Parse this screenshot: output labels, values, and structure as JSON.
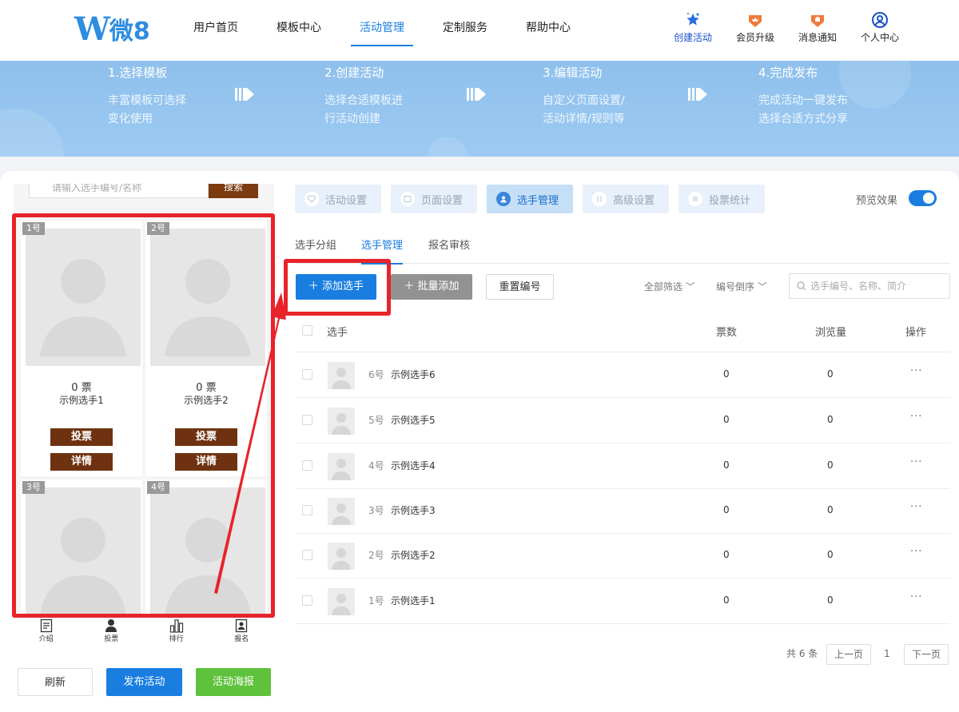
{
  "header": {
    "logo": {
      "w": "W",
      "text": "微8"
    },
    "nav": [
      "用户首页",
      "模板中心",
      "活动管理",
      "定制服务",
      "帮助中心"
    ],
    "active_nav": "活动管理",
    "icons": [
      {
        "label": "创建活动",
        "icon": "star-icon",
        "color": "#1a50c8"
      },
      {
        "label": "会员升级",
        "icon": "crown-badge-icon",
        "color": "#f07a3a"
      },
      {
        "label": "消息通知",
        "icon": "bell-badge-icon",
        "color": "#f07a3a"
      },
      {
        "label": "个人中心",
        "icon": "user-icon",
        "color": "#1a50c8"
      }
    ]
  },
  "banner": {
    "steps": [
      {
        "title": "1.选择模板",
        "l1": "丰富模板可选择",
        "l2": "变化使用"
      },
      {
        "title": "2.创建活动",
        "l1": "选择合适模板进",
        "l2": "行活动创建"
      },
      {
        "title": "3.编辑活动",
        "l1": "自定义页面设置/",
        "l2": "活动详情/规则等"
      },
      {
        "title": "4.完成发布",
        "l1": "完成活动一键发布",
        "l2": "选择合适方式分享"
      }
    ]
  },
  "preview": {
    "search_placeholder": "请输入选手编号/名称",
    "search_btn": "搜索",
    "tiles": [
      {
        "no": "1号",
        "votes": "0 票",
        "name": "示例选手1",
        "vote_btn": "投票",
        "detail_btn": "详情"
      },
      {
        "no": "2号",
        "votes": "0 票",
        "name": "示例选手2",
        "vote_btn": "投票",
        "detail_btn": "详情"
      },
      {
        "no": "3号"
      },
      {
        "no": "4号"
      }
    ],
    "bottom_tabs": [
      "介绍",
      "投票",
      "排行",
      "报名"
    ]
  },
  "actions": {
    "refresh": "刷新",
    "publish": "发布活动",
    "poster": "活动海报"
  },
  "tabs": [
    "活动设置",
    "页面设置",
    "选手管理",
    "高级设置",
    "投票统计"
  ],
  "active_tab": "选手管理",
  "preview_label": "预览效果",
  "subtabs": [
    "选手分组",
    "选手管理",
    "报名审核"
  ],
  "toolbar": {
    "add": "＋ 添加选手",
    "batch": "＋ 批量添加",
    "reset": "重置编号",
    "filter_all": "全部筛选",
    "sort": "编号倒序",
    "search_placeholder": "选手编号、名称、简介"
  },
  "table": {
    "headers": {
      "player": "选手",
      "votes": "票数",
      "views": "浏览量",
      "ops": "操作"
    },
    "rows": [
      {
        "no": "6号",
        "name": "示例选手6",
        "votes": "0",
        "views": "0"
      },
      {
        "no": "5号",
        "name": "示例选手5",
        "votes": "0",
        "views": "0"
      },
      {
        "no": "4号",
        "name": "示例选手4",
        "votes": "0",
        "views": "0"
      },
      {
        "no": "3号",
        "name": "示例选手3",
        "votes": "0",
        "views": "0"
      },
      {
        "no": "2号",
        "name": "示例选手2",
        "votes": "0",
        "views": "0"
      },
      {
        "no": "1号",
        "name": "示例选手1",
        "votes": "0",
        "views": "0"
      }
    ],
    "ops_glyph": "···"
  },
  "pagination": {
    "total": "共 6 条",
    "prev": "上一页",
    "page": "1",
    "next": "下一页"
  },
  "colors": {
    "accent": "#1a7ee0",
    "brand_brown": "#6e3210",
    "annotation_red": "#e8232a",
    "poster_green": "#5fc23c"
  }
}
